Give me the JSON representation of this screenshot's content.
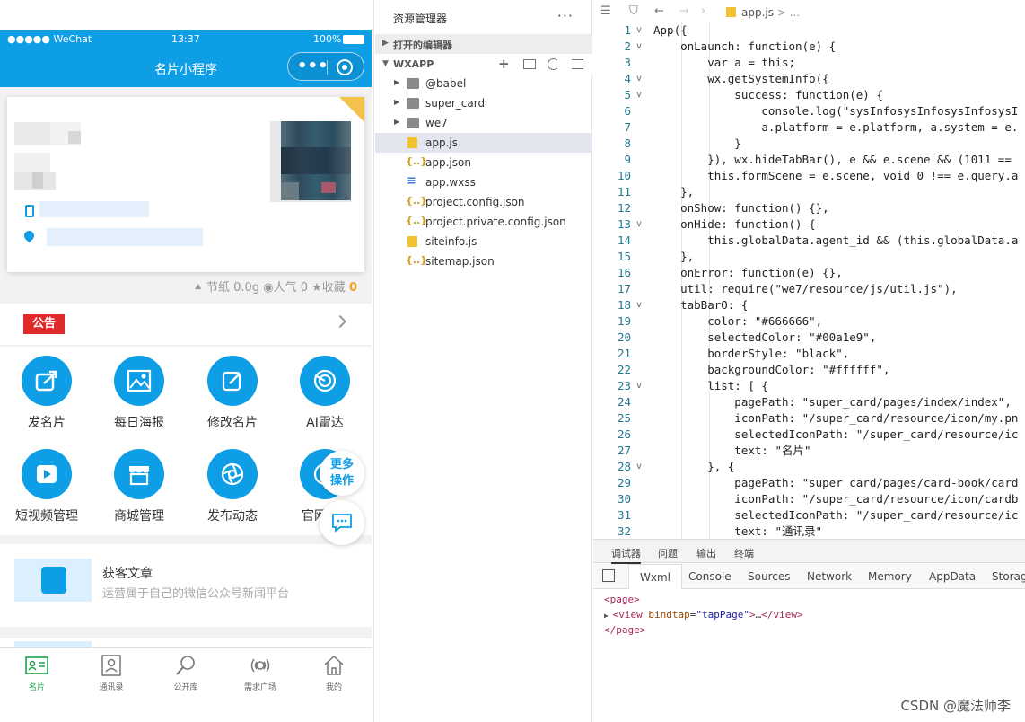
{
  "simulator": {
    "status": {
      "carrier": "●●●●● WeChat",
      "time": "13:37",
      "battery": "100%"
    },
    "nav_title": "名片小程序",
    "capsule_more": "•••",
    "stats": {
      "paper_label": "节纸",
      "paper_value": "0.0g",
      "pop_label": "人气",
      "pop_value": "0",
      "fav_label": "收藏",
      "fav_value": "0"
    },
    "notice_label": "公告",
    "grid": [
      {
        "label": "发名片",
        "icon": "share-icon"
      },
      {
        "label": "每日海报",
        "icon": "image-icon"
      },
      {
        "label": "修改名片",
        "icon": "edit-icon"
      },
      {
        "label": "AI雷达",
        "icon": "radar-icon"
      },
      {
        "label": "短视频管理",
        "icon": "video-icon"
      },
      {
        "label": "商城管理",
        "icon": "shop-icon"
      },
      {
        "label": "发布动态",
        "icon": "camera-icon"
      },
      {
        "label": "官网",
        "icon": "website-icon"
      }
    ],
    "more_line1": "更多",
    "more_line2": "操作",
    "article": {
      "title": "获客文章",
      "desc": "运营属于自己的微信公众号新闻平台"
    },
    "tabs": [
      {
        "label": "名片",
        "active": true
      },
      {
        "label": "通讯录",
        "active": false
      },
      {
        "label": "公开库",
        "active": false
      },
      {
        "label": "需求广场",
        "active": false
      },
      {
        "label": "我的",
        "active": false
      }
    ],
    "colors": {
      "primary": "#0d9ee6",
      "notice": "#e02a2a",
      "active_tab": "#1aa34a"
    }
  },
  "explorer": {
    "title": "资源管理器",
    "more": "···",
    "open_editors": "打开的编辑器",
    "project": "WXAPP",
    "items": [
      {
        "name": "@babel",
        "type": "folder"
      },
      {
        "name": "super_card",
        "type": "folder"
      },
      {
        "name": "we7",
        "type": "folder"
      },
      {
        "name": "app.js",
        "type": "js",
        "selected": true
      },
      {
        "name": "app.json",
        "type": "json"
      },
      {
        "name": "app.wxss",
        "type": "wxss"
      },
      {
        "name": "project.config.json",
        "type": "json"
      },
      {
        "name": "project.private.config.json",
        "type": "json"
      },
      {
        "name": "siteinfo.js",
        "type": "js"
      },
      {
        "name": "sitemap.json",
        "type": "json"
      }
    ]
  },
  "editor": {
    "breadcrumb_file": "app.js",
    "breadcrumb_rest": "> ...",
    "lines": [
      {
        "n": "1",
        "fold": "v",
        "text": "App({"
      },
      {
        "n": "2",
        "fold": "v",
        "text": "    onLaunch: function(e) {"
      },
      {
        "n": "3",
        "fold": "",
        "text": "        var a = this;"
      },
      {
        "n": "4",
        "fold": "v",
        "text": "        wx.getSystemInfo({"
      },
      {
        "n": "5",
        "fold": "v",
        "text": "            success: function(e) {"
      },
      {
        "n": "6",
        "fold": "",
        "text": "                console.log(\"sysInfosysInfosysInfosysI"
      },
      {
        "n": "7",
        "fold": "",
        "text": "                a.platform = e.platform, a.system = e."
      },
      {
        "n": "8",
        "fold": "",
        "text": "            }"
      },
      {
        "n": "9",
        "fold": "",
        "text": "        }), wx.hideTabBar(), e && e.scene && (1011 =="
      },
      {
        "n": "10",
        "fold": "",
        "text": "        this.formScene = e.scene, void 0 !== e.query.a"
      },
      {
        "n": "11",
        "fold": "",
        "text": "    },"
      },
      {
        "n": "12",
        "fold": "",
        "text": "    onShow: function() {},"
      },
      {
        "n": "13",
        "fold": "v",
        "text": "    onHide: function() {"
      },
      {
        "n": "14",
        "fold": "",
        "text": "        this.globalData.agent_id && (this.globalData.a"
      },
      {
        "n": "15",
        "fold": "",
        "text": "    },"
      },
      {
        "n": "16",
        "fold": "",
        "text": "    onError: function(e) {},"
      },
      {
        "n": "17",
        "fold": "",
        "text": "    util: require(\"we7/resource/js/util.js\"),"
      },
      {
        "n": "18",
        "fold": "v",
        "text": "    tabBarO: {"
      },
      {
        "n": "19",
        "fold": "",
        "text": "        color: \"#666666\","
      },
      {
        "n": "20",
        "fold": "",
        "text": "        selectedColor: \"#00a1e9\","
      },
      {
        "n": "21",
        "fold": "",
        "text": "        borderStyle: \"black\","
      },
      {
        "n": "22",
        "fold": "",
        "text": "        backgroundColor: \"#ffffff\","
      },
      {
        "n": "23",
        "fold": "v",
        "text": "        list: [ {"
      },
      {
        "n": "24",
        "fold": "",
        "text": "            pagePath: \"super_card/pages/index/index\","
      },
      {
        "n": "25",
        "fold": "",
        "text": "            iconPath: \"/super_card/resource/icon/my.pn"
      },
      {
        "n": "26",
        "fold": "",
        "text": "            selectedIconPath: \"/super_card/resource/ic"
      },
      {
        "n": "27",
        "fold": "",
        "text": "            text: \"名片\""
      },
      {
        "n": "28",
        "fold": "v",
        "text": "        }, {"
      },
      {
        "n": "29",
        "fold": "",
        "text": "            pagePath: \"super_card/pages/card-book/card"
      },
      {
        "n": "30",
        "fold": "",
        "text": "            iconPath: \"/super_card/resource/icon/cardb"
      },
      {
        "n": "31",
        "fold": "",
        "text": "            selectedIconPath: \"/super_card/resource/ic"
      },
      {
        "n": "32",
        "fold": "",
        "text": "            text: \"通讯录\""
      }
    ]
  },
  "bottom": {
    "tabs": [
      "调试器",
      "问题",
      "输出",
      "终端"
    ],
    "devtools_tabs": [
      "Wxml",
      "Console",
      "Sources",
      "Network",
      "Memory",
      "AppData",
      "Storag"
    ],
    "dom": {
      "open": "<page>",
      "child_tag": "view",
      "attr": "bindtap",
      "attr_val": "\"tapPage\"",
      "ellipsis": "…",
      "close": "</page>"
    }
  },
  "watermark": "CSDN @魔法师李"
}
